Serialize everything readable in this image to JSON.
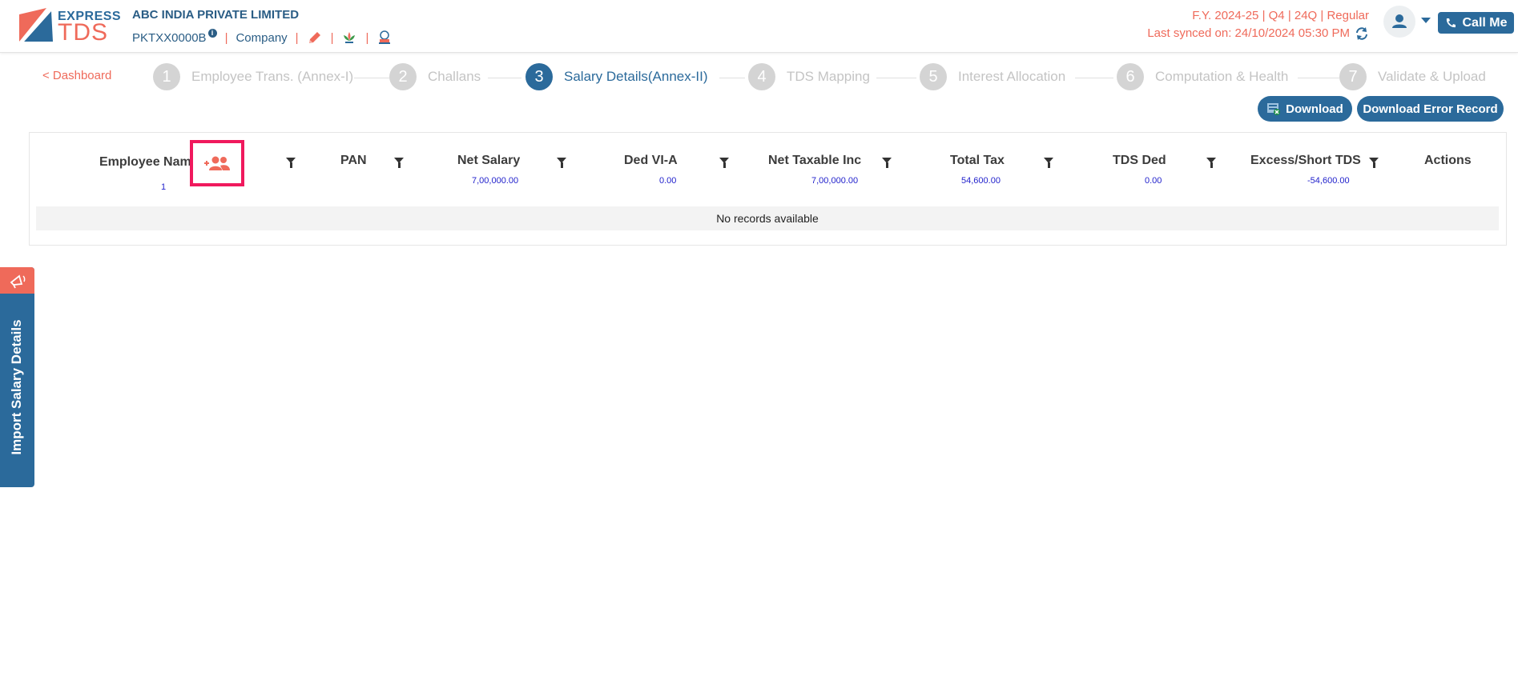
{
  "header": {
    "logo_express": "EXPRESS",
    "logo_tds": "TDS",
    "company_name": "ABC INDIA PRIVATE LIMITED",
    "tan": "PKTXX0000B",
    "info_glyph": "i",
    "sep": "|",
    "role": "Company",
    "fy_line": "F.Y. 2024-25  | Q4  | 24Q | Regular",
    "sync_line": "Last synced on: 24/10/2024 05:30 PM",
    "callme_label": "Call Me"
  },
  "stepper": {
    "back_label": "< Dashboard",
    "steps": [
      {
        "num": "1",
        "label": "Employee Trans. (Annex-I)",
        "active": false
      },
      {
        "num": "2",
        "label": "Challans",
        "active": false
      },
      {
        "num": "3",
        "label": "Salary Details(Annex-II)",
        "active": true
      },
      {
        "num": "4",
        "label": "TDS Mapping",
        "active": false
      },
      {
        "num": "5",
        "label": "Interest Allocation",
        "active": false
      },
      {
        "num": "6",
        "label": "Computation & Health",
        "active": false
      },
      {
        "num": "7",
        "label": "Validate & Upload",
        "active": false
      }
    ]
  },
  "actions": {
    "download_label": "Download",
    "download_error_label": "Download Error Record"
  },
  "table": {
    "columns": [
      {
        "header": "Employee Name",
        "summary": "1"
      },
      {
        "header": "PAN",
        "summary": ""
      },
      {
        "header": "Net Salary",
        "summary": "7,00,000.00"
      },
      {
        "header": "Ded VI-A",
        "summary": "0.00"
      },
      {
        "header": "Net Taxable Inc",
        "summary": "7,00,000.00"
      },
      {
        "header": "Total Tax",
        "summary": "54,600.00"
      },
      {
        "header": "TDS Ded",
        "summary": "0.00"
      },
      {
        "header": "Excess/Short TDS",
        "summary": "-54,600.00"
      },
      {
        "header": "Actions",
        "summary": ""
      }
    ],
    "empty_message": "No records available"
  },
  "side_tab": {
    "label": "Import Salary Details"
  },
  "colors": {
    "primary": "#2b6a9b",
    "accent": "#ef6a5a",
    "highlight": "#f0195d"
  },
  "icons": [
    "pencil-icon",
    "lotus-icon",
    "emblem-icon",
    "refresh-icon",
    "user-icon",
    "phone-icon",
    "excel-icon",
    "add-employee-icon",
    "filter-icon",
    "megaphone-icon"
  ]
}
